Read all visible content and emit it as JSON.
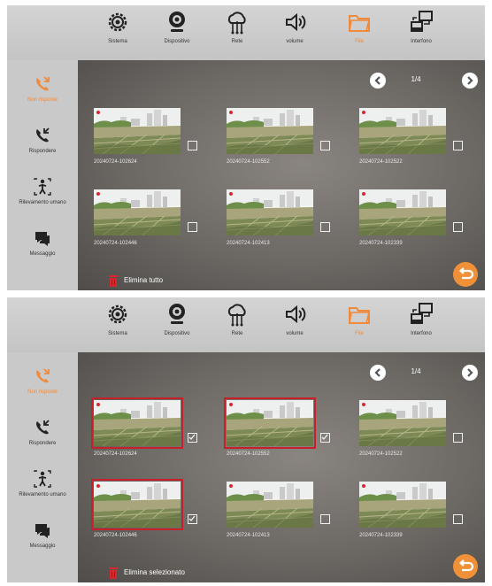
{
  "topbar": {
    "items": [
      {
        "label": "Sistema",
        "icon": "gear-icon",
        "active": false
      },
      {
        "label": "Dispositivo",
        "icon": "webcam-icon",
        "active": false
      },
      {
        "label": "Rete",
        "icon": "cloud-network-icon",
        "active": false
      },
      {
        "label": "volume",
        "icon": "speaker-icon",
        "active": false
      },
      {
        "label": "File",
        "icon": "folder-icon",
        "active": true
      },
      {
        "label": "Interfono",
        "icon": "intercom-icon",
        "active": false
      }
    ]
  },
  "sidebar": {
    "items": [
      {
        "label": "Non risposte",
        "icon": "missed-call-icon",
        "active": true
      },
      {
        "label": "Rispondere",
        "icon": "answered-call-icon",
        "active": false
      },
      {
        "label": "Rilevamento umano",
        "icon": "human-detection-icon",
        "active": false
      },
      {
        "label": "Messaggio",
        "icon": "message-icon",
        "active": false
      }
    ]
  },
  "pager": {
    "text": "1/4"
  },
  "colors": {
    "accent": "#f08a3c",
    "selection": "#c8202a",
    "delete": "#d8262c"
  },
  "panels": [
    {
      "delete_label": "Elimina tutto",
      "thumbs": [
        {
          "name": "20240724-102624",
          "selected": false
        },
        {
          "name": "20240724-102552",
          "selected": false
        },
        {
          "name": "20240724-102522",
          "selected": false
        },
        {
          "name": "20240724-102446",
          "selected": false
        },
        {
          "name": "20240724-102413",
          "selected": false
        },
        {
          "name": "20240724-102339",
          "selected": false
        }
      ]
    },
    {
      "delete_label": "Elimina selezionato",
      "thumbs": [
        {
          "name": "20240724-102624",
          "selected": true
        },
        {
          "name": "20240724-102552",
          "selected": true
        },
        {
          "name": "20240724-102522",
          "selected": false
        },
        {
          "name": "20240724-102446",
          "selected": true
        },
        {
          "name": "20240724-102413",
          "selected": false
        },
        {
          "name": "20240724-102339",
          "selected": false
        }
      ]
    }
  ]
}
